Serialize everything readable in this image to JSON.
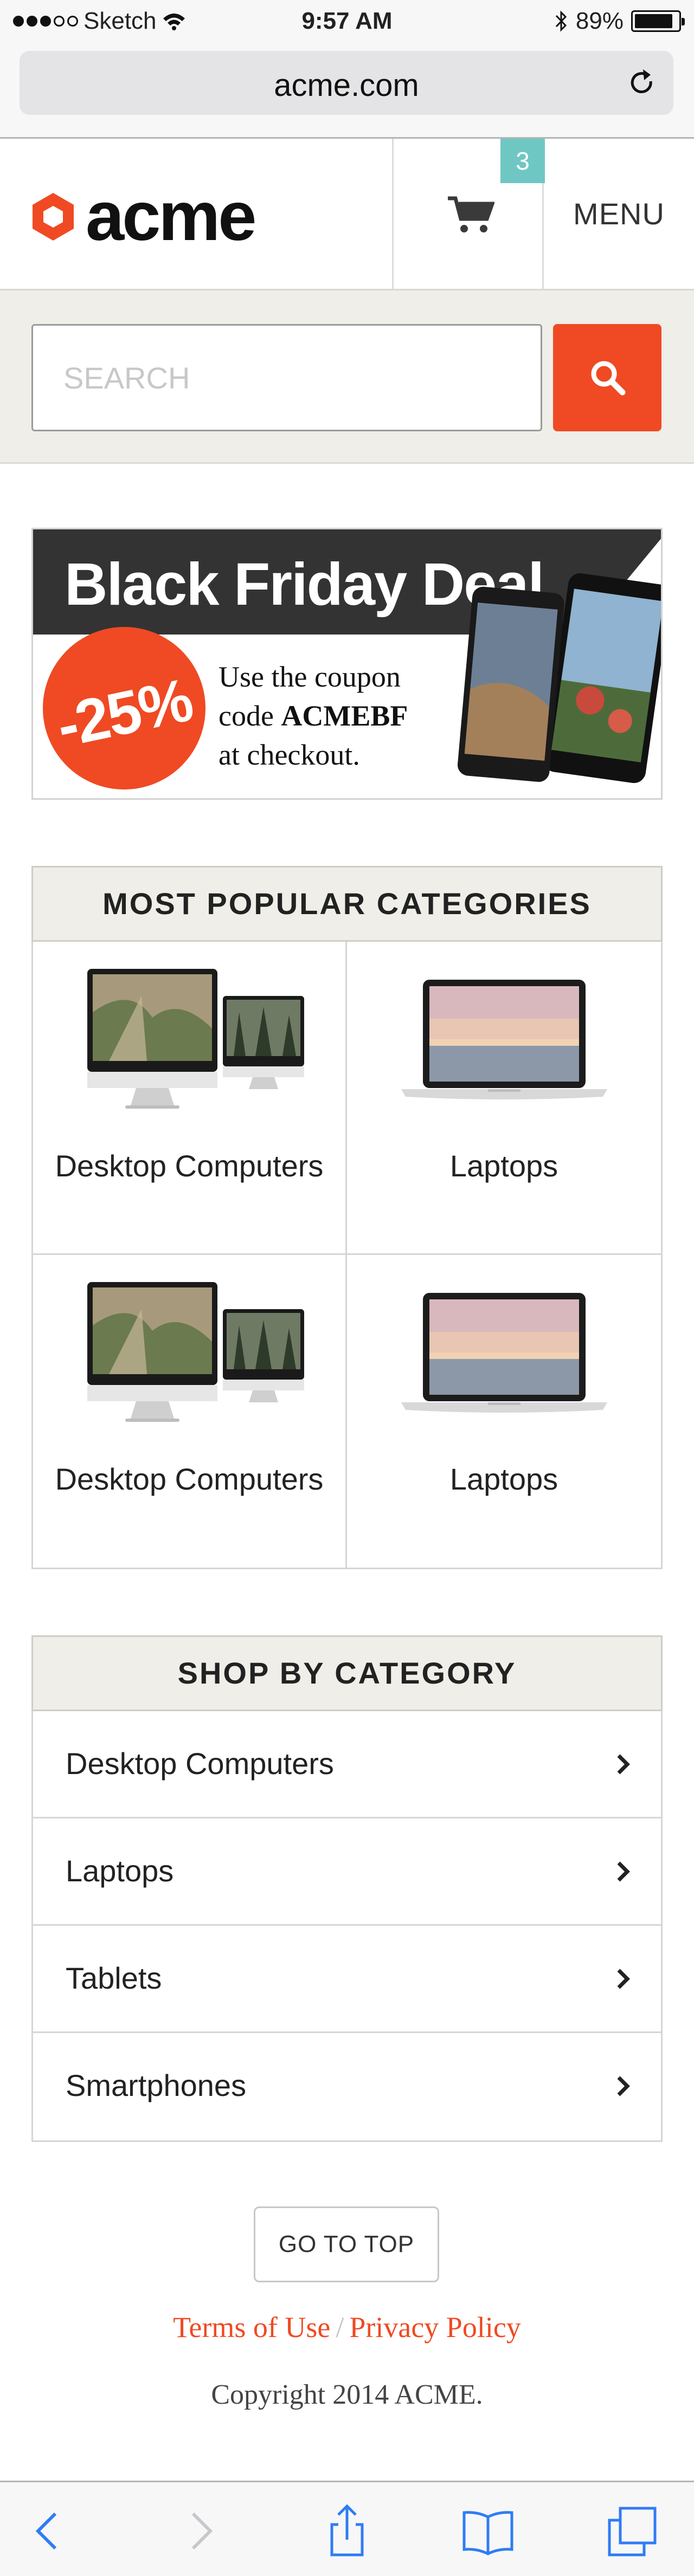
{
  "status_bar": {
    "carrier": "Sketch",
    "time": "9:57 AM",
    "battery": "89%",
    "battery_level": 0.89
  },
  "browser": {
    "url": "acme.com"
  },
  "header": {
    "logo_text": "acme",
    "cart_count": "3",
    "menu_label": "MENU"
  },
  "search": {
    "placeholder": "SEARCH"
  },
  "banner": {
    "title": "Black Friday Deal",
    "discount": "-25%",
    "coupon_line1": "Use the coupon",
    "coupon_line2_prefix": "code ",
    "coupon_code": "ACMEBF",
    "coupon_line3": "at checkout."
  },
  "popular": {
    "title": "MOST POPULAR CATEGORIES",
    "items": [
      {
        "label": "Desktop Computers",
        "image": "desktop-computers"
      },
      {
        "label": "Laptops",
        "image": "laptop"
      },
      {
        "label": "Desktop Computers",
        "image": "desktop-computers"
      },
      {
        "label": "Laptops",
        "image": "laptop"
      }
    ]
  },
  "shop": {
    "title": "SHOP BY CATEGORY",
    "items": [
      {
        "label": "Desktop Computers"
      },
      {
        "label": "Laptops"
      },
      {
        "label": "Tablets"
      },
      {
        "label": "Smartphones"
      }
    ]
  },
  "footer": {
    "go_to_top": "GO TO TOP",
    "terms": "Terms of Use",
    "separator": "/",
    "privacy": "Privacy Policy",
    "copyright": "Copyright 2014 ACME."
  },
  "colors": {
    "accent": "#ef4a23",
    "badge": "#6fc7c3",
    "band": "#efeee8",
    "ios_blue": "#2f7cf6"
  }
}
